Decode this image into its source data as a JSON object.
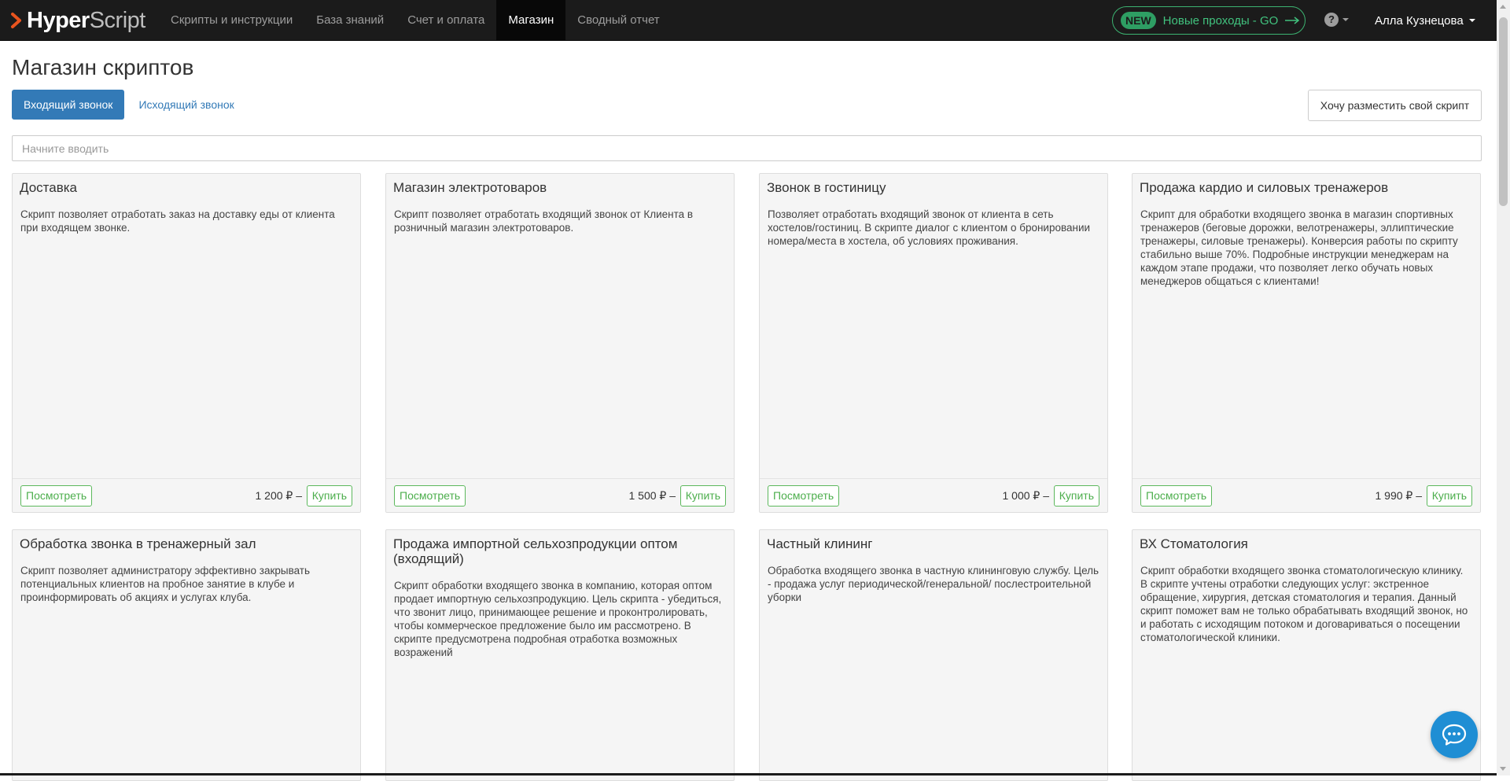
{
  "logo": {
    "text_bold": "Hyper",
    "text_light": "Script"
  },
  "nav": {
    "items": [
      {
        "label": "Скрипты и инструкции",
        "active": false
      },
      {
        "label": "База знаний",
        "active": false
      },
      {
        "label": "Счет и оплата",
        "active": false
      },
      {
        "label": "Магазин",
        "active": true
      },
      {
        "label": "Сводный отчет",
        "active": false
      }
    ],
    "promo": {
      "badge": "NEW",
      "label": "Новые проходы - GO"
    },
    "help_icon": "?",
    "user_name": "Алла Кузнецова"
  },
  "page": {
    "title": "Магазин скриптов",
    "tabs": [
      {
        "label": "Входящий звонок",
        "active": true
      },
      {
        "label": "Исходящий звонок",
        "active": false
      }
    ],
    "place_button": "Хочу разместить свой скрипт",
    "search_placeholder": "Начните вводить"
  },
  "cards": [
    {
      "title": "Доставка",
      "description": "Скрипт позволяет отработать заказ на доставку еды от клиента при входящем звонке.",
      "price": "1 200 ₽ –",
      "view_label": "Посмотреть",
      "buy_label": "Купить"
    },
    {
      "title": "Магазин электротоваров",
      "description": "Скрипт позволяет отработать входящий звонок от Клиента в розничный магазин электротоваров.",
      "price": "1 500 ₽ –",
      "view_label": "Посмотреть",
      "buy_label": "Купить"
    },
    {
      "title": "Звонок в гостиницу",
      "description": "Позволяет отработать входящий звонок от клиента в сеть хостелов/гостиниц. В скрипте диалог с клиентом о бронировании номера/места в хостела, об условиях проживания.",
      "price": "1 000 ₽ –",
      "view_label": "Посмотреть",
      "buy_label": "Купить"
    },
    {
      "title": "Продажа кардио и силовых тренажеров",
      "description": "Скрипт для обработки входящего звонка в магазин спортивных тренажеров (беговые дорожки, велотренажеры, эллиптические тренажеры, силовые тренажеры). Конверсия работы по скрипту стабильно выше 70%. Подробные инструкции менеджерам на каждом этапе продажи, что позволяет легко обучать новых менеджеров общаться с клиентами!",
      "price": "1 990 ₽ –",
      "view_label": "Посмотреть",
      "buy_label": "Купить"
    },
    {
      "title": "Обработка звонка в тренажерный зал",
      "description": "Скрипт позволяет администратору эффективно закрывать потенциальных клиентов на пробное занятие в клубе и проинформировать об акциях и услугах клуба."
    },
    {
      "title": "Продажа импортной сельхозпродукции оптом (входящий)",
      "description": "Скрипт обработки входящего звонка в компанию, которая оптом продает импортную сельхозпродукцию. Цель скрипта - убедиться, что звонит лицо, принимающее решение и проконтролировать, чтобы коммерческое предложение было им рассмотрено. В скрипте предусмотрена подробная отработка возможных возражений"
    },
    {
      "title": "Частный клининг",
      "description": "Обработка входящего звонка в частную клининговую службу. Цель - продажа услуг периодической/генеральной/ послестроительной уборки"
    },
    {
      "title": "ВХ Стоматология",
      "description": "Скрипт обработки входящего звонка стоматологическую клинику. В скрипте учтены отработки следующих услуг: экстренное обращение, хирургия, детская стоматология и терапия. Данный скрипт поможет вам не только обрабатывать входящий звонок, но и работать с исходящим потоком и договариваться о посещении стоматологической клиники."
    }
  ],
  "colors": {
    "navbar_bg": "#1b1b1b",
    "primary": "#337ab7",
    "success": "#5cb85c",
    "promo_green": "#41c27e",
    "chat_blue": "#1f8ed4"
  }
}
